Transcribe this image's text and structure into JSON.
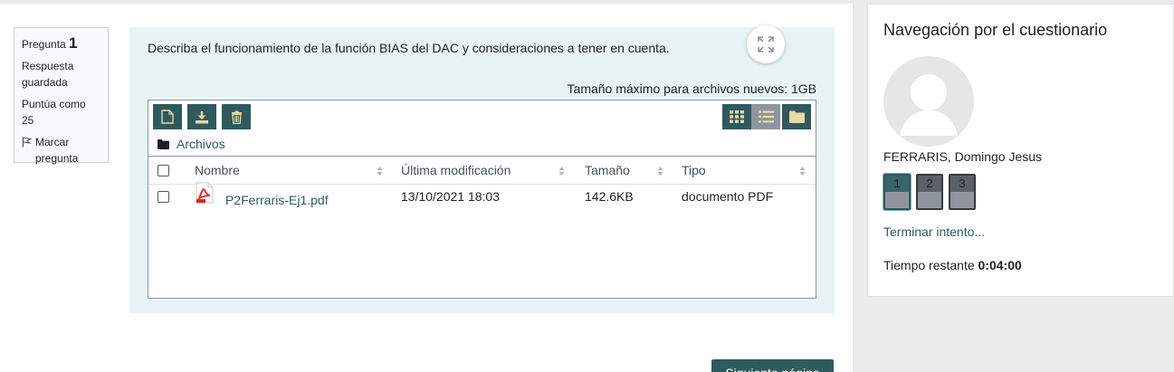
{
  "question_info": {
    "label": "Pregunta",
    "number": "1",
    "status": "Respuesta guardada",
    "grade": "Puntúa como 25",
    "flag_label": "Marcar pregunta"
  },
  "question": {
    "text": "Describa el funcionamiento de la función BIAS del DAC y consideraciones a tener en cuenta.",
    "max_size": "Tamaño máximo para archivos nuevos: 1GB"
  },
  "file_picker": {
    "path_label": "Archivos",
    "columns": [
      "Nombre",
      "Última modificación",
      "Tamaño",
      "Tipo"
    ],
    "files": [
      {
        "name": "P2Ferraris-Ej1.pdf",
        "modified": "13/10/2021 18:03",
        "size": "142.6KB",
        "type": "documento PDF"
      }
    ]
  },
  "next_button": "Siguiente página",
  "nav": {
    "title": "Navegación por el cuestionario",
    "user_name": "FERRARIS, Domingo Jesus",
    "questions": [
      "1",
      "2",
      "3"
    ],
    "finish_link": "Terminar intento...",
    "timer_label": "Tiempo restante",
    "timer_value": "0:04:00"
  },
  "colors": {
    "accent": "#2f5a5e",
    "content_bg": "#e7f3f5"
  }
}
